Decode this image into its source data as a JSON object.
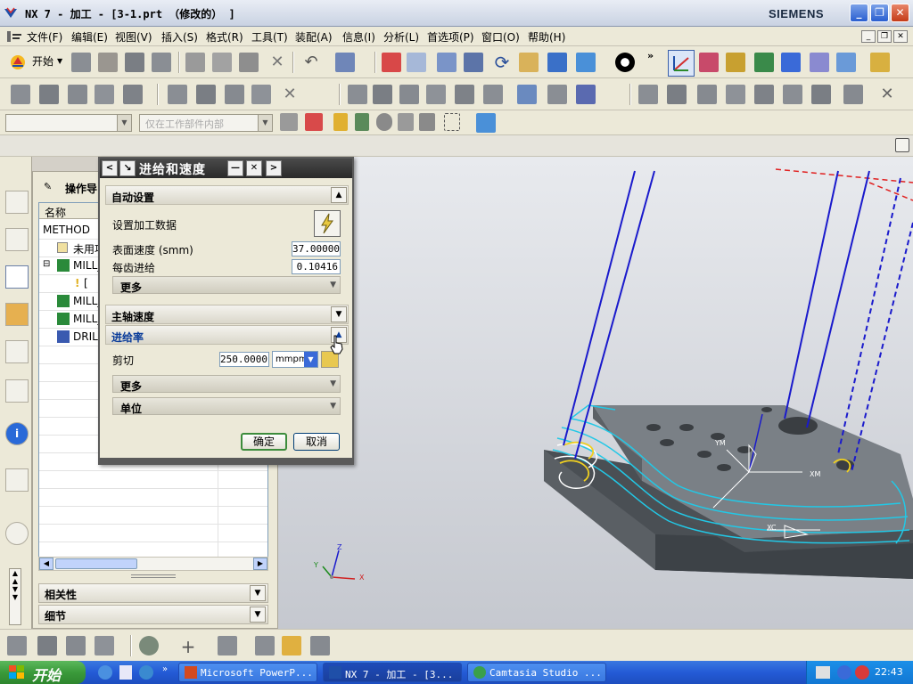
{
  "window": {
    "title": "NX 7 - 加工 - [3-1.prt （修改的） ]",
    "brand": "SIEMENS",
    "btn_min": "_",
    "btn_max": "❐",
    "btn_close": "✕"
  },
  "menu": {
    "items": [
      "文件(F)",
      "编辑(E)",
      "视图(V)",
      "插入(S)",
      "格式(R)",
      "工具(T)",
      "装配(A)",
      "信息(I)",
      "分析(L)",
      "首选项(P)",
      "窗口(O)",
      "帮助(H)"
    ]
  },
  "toolbar": {
    "start_label": "开始",
    "filter_placeholder": "仅在工作部件内部"
  },
  "navigator": {
    "title": "操作导",
    "col_name": "名称",
    "rows": [
      "METHOD",
      "未用项",
      "MILL_",
      "[",
      "MILL_",
      "MILL_",
      "DRILL"
    ],
    "panel_related": "相关性",
    "panel_details": "细节"
  },
  "dialog": {
    "title": "进给和速度",
    "section_auto": "自动设置",
    "set_data_label": "设置加工数据",
    "surface_speed_label": "表面速度 (smm)",
    "surface_speed_value": "37.00000",
    "feed_per_tooth_label": "每齿进给",
    "feed_per_tooth_value": "0.10416",
    "more1": "更多",
    "section_spindle": "主轴速度",
    "section_feed": "进给率",
    "cut_label": "剪切",
    "cut_value": "250.0000",
    "cut_unit": "mmpm",
    "more2": "更多",
    "units": "单位",
    "ok": "确定",
    "cancel": "取消"
  },
  "graphics": {
    "axis_x": "X",
    "axis_y": "Y",
    "axis_z": "Z",
    "label_xm": "XM",
    "label_ym": "YM",
    "label_xc": "XC"
  },
  "taskbar": {
    "start": "开始",
    "items": [
      "Microsoft PowerP...",
      "NX 7 - 加工 - [3...",
      "Camtasia Studio ..."
    ],
    "clock": "22:43"
  },
  "colors": {
    "toolpath_blue": "#1a1acc",
    "toolpath_cyan": "#22c8e6",
    "part_gray": "#6e7479",
    "accent_red": "#e02020"
  }
}
